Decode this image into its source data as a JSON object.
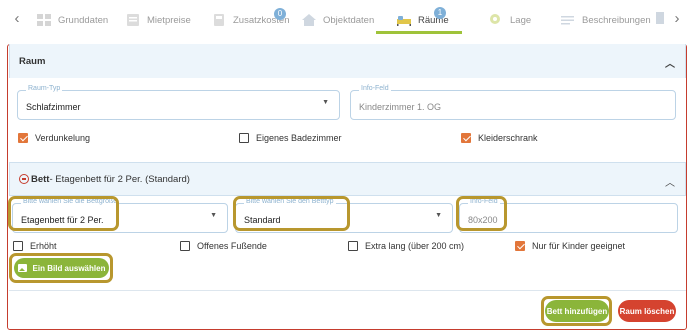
{
  "tabs": [
    {
      "label": "Grunddaten",
      "icon": "grid-icon"
    },
    {
      "label": "Mietpreise",
      "icon": "price-list-icon"
    },
    {
      "label": "Zusatzkosten",
      "icon": "calculator-icon",
      "badge": "0"
    },
    {
      "label": "Objektdaten",
      "icon": "house-icon"
    },
    {
      "label": "Räume",
      "icon": "bed-icon",
      "badge": "1",
      "active": true
    },
    {
      "label": "Lage",
      "icon": "location-pin-icon"
    },
    {
      "label": "Beschreibungen",
      "icon": "text-lines-icon"
    }
  ],
  "raum": {
    "title": "Raum",
    "raum_typ_label": "Raum-Typ",
    "raum_typ_value": "Schlafzimmer",
    "info_label": "Info-Feld",
    "info_value": "Kinderzimmer 1. OG",
    "checkboxes": [
      {
        "label": "Verdunkelung",
        "checked": true
      },
      {
        "label": "Eigenes Badezimmer",
        "checked": false
      },
      {
        "label": "Kleiderschrank",
        "checked": true
      }
    ]
  },
  "bett": {
    "title_bold": "Bett",
    "title_rest": " - Etagenbett für 2 Per. (Standard)",
    "size_label": "Bitte wählen Sie die Bettgröße",
    "size_value": "Etagenbett für 2 Per.",
    "type_label": "Bitte wählen Sie den Betttyp",
    "type_value": "Standard",
    "info_label": "Info-Feld",
    "info_value": "80x200",
    "checkboxes": [
      {
        "label": "Erhöht",
        "checked": false
      },
      {
        "label": "Offenes Fußende",
        "checked": false
      },
      {
        "label": "Extra lang (über 200 cm)",
        "checked": false
      },
      {
        "label": "Nur für Kinder geeignet",
        "checked": true
      }
    ],
    "image_button": "Ein Bild auswählen"
  },
  "actions": {
    "add_bed": "Bett hinzufügen",
    "delete_room": "Raum löschen"
  },
  "colors": {
    "accent_green": "#8bb53a",
    "danger_red": "#d5432f",
    "highlight_gold": "#b8972e",
    "checkbox_orange": "#e2763a",
    "panel_header_blue": "#edf5fb"
  }
}
